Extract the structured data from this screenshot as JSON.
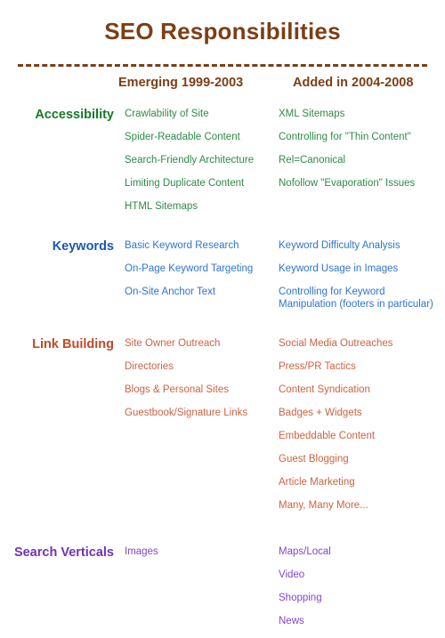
{
  "page": {
    "title": "SEO Responsibilities",
    "divider": "dashed-horizontal-rule"
  },
  "columns": {
    "header1": "Emerging 1999-2003",
    "header2": "Added in 2004-2008"
  },
  "colors": {
    "title": "#7B3F16",
    "divider": "#7B3F16",
    "column_header": "#7B3F16",
    "accessibility_label": "#17792A",
    "accessibility_item": "#2E8B45",
    "keywords_label": "#1B57B8",
    "keywords_item": "#2E74D0",
    "link_building_label": "#C14A28",
    "link_building_item": "#CC6343",
    "search_verticals_label": "#7232B8",
    "search_verticals_item": "#8248C9"
  },
  "sections": [
    {
      "label": "Accessibility",
      "emerging": [
        "Crawlability of Site",
        "Spider-Readable Content",
        "Search-Friendly Architecture",
        "Limiting Duplicate Content",
        "HTML Sitemaps"
      ],
      "added": [
        "XML Sitemaps",
        "Controlling for \"Thin Content\"",
        "Rel=Canonical",
        "Nofollow \"Evaporation\" Issues"
      ]
    },
    {
      "label": "Keywords",
      "emerging": [
        "Basic Keyword Research",
        "On-Page Keyword Targeting",
        "On-Site Anchor Text"
      ],
      "added": [
        "Keyword Difficulty Analysis",
        "Keyword Usage in Images",
        "Controlling for Keyword Manipulation (footers in particular)"
      ]
    },
    {
      "label": "Link Building",
      "emerging": [
        "Site Owner Outreach",
        "Directories",
        "Blogs & Personal Sites",
        "Guestbook/Signature Links"
      ],
      "added": [
        "Social Media Outreaches",
        "Press/PR Tactics",
        "Content Syndication",
        "Badges + Widgets",
        "Embeddable Content",
        "Guest Blogging",
        "Article Marketing",
        "Many, Many More..."
      ]
    },
    {
      "label": "Search Verticals",
      "emerging": [
        "Images"
      ],
      "added": [
        "Maps/Local",
        "Video",
        "Shopping",
        "News"
      ]
    }
  ]
}
